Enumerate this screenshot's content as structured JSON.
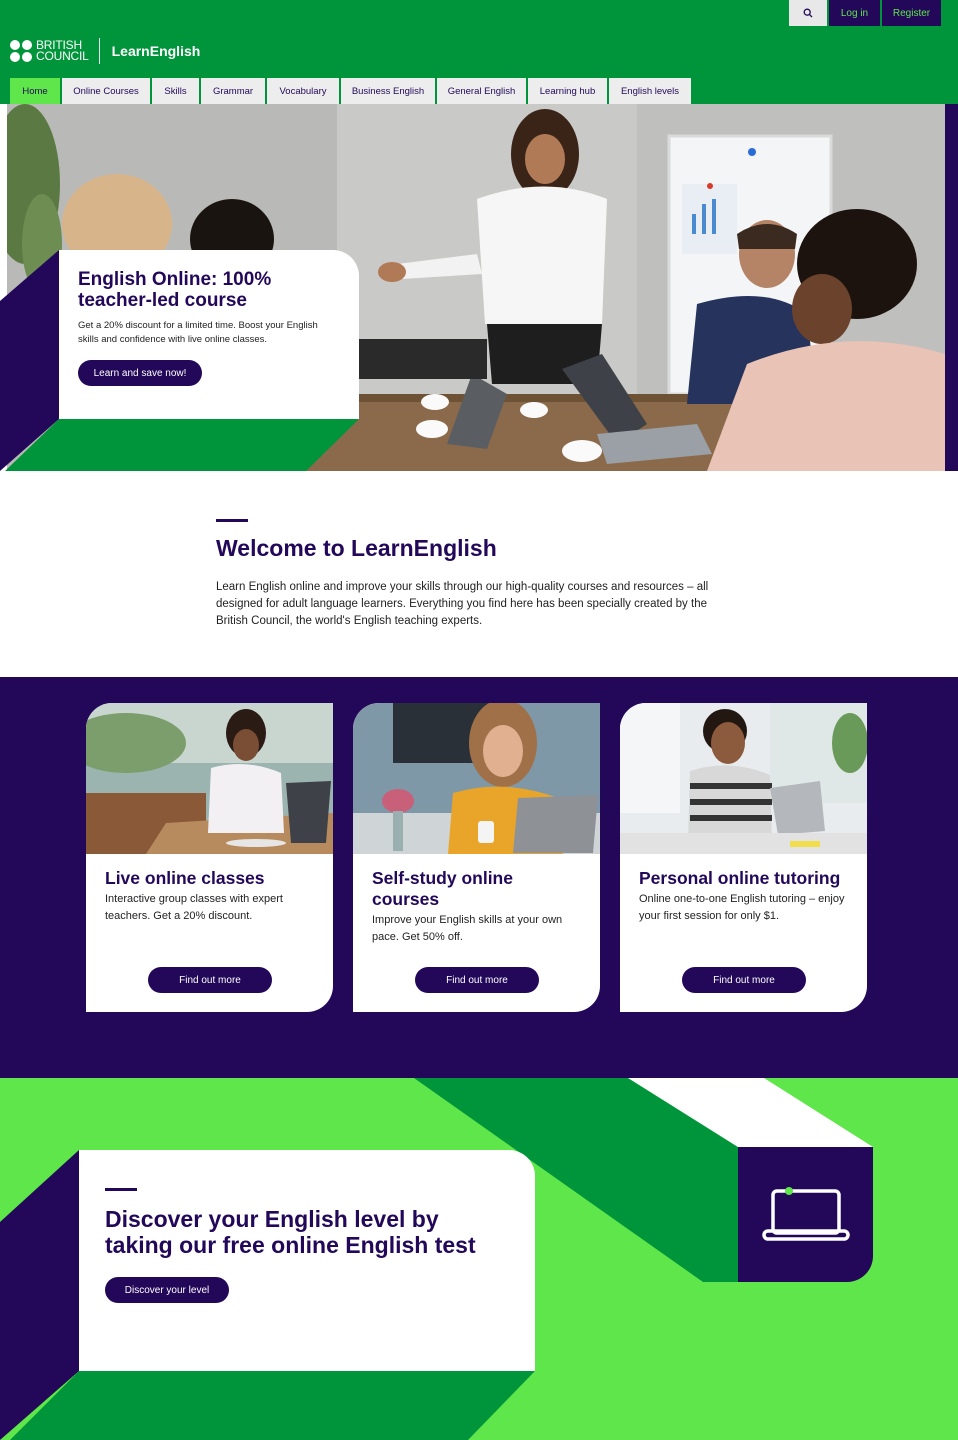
{
  "header": {
    "site_name": "LearnEnglish",
    "logo_line1": "BRITISH",
    "logo_line2": "COUNCIL",
    "search_icon": "search-icon",
    "login_label": "Log in",
    "register_label": "Register",
    "nav": [
      {
        "label": "Home",
        "active": true
      },
      {
        "label": "Online Courses"
      },
      {
        "label": "Skills"
      },
      {
        "label": "Grammar"
      },
      {
        "label": "Vocabulary"
      },
      {
        "label": "Business English"
      },
      {
        "label": "General English"
      },
      {
        "label": "Learning hub"
      },
      {
        "label": "English levels"
      }
    ]
  },
  "hero": {
    "title": "English Online: 100% teacher-led course",
    "text": "Get a 20% discount for a limited time. Boost your English skills and confidence with live online classes.",
    "button": "Learn and save now!"
  },
  "welcome": {
    "title": "Welcome to LearnEnglish",
    "text": "Learn English online and improve your skills through our high-quality courses and resources – all designed for adult language learners. Everything you find here has been specially created by the British Council, the world's English teaching experts."
  },
  "cards": [
    {
      "title": "Live online classes",
      "text": "Interactive group classes with expert teachers. Get a 20% discount.",
      "button": "Find out more"
    },
    {
      "title": "Self-study online courses",
      "text": "Improve your English skills at your own pace. Get 50% off.",
      "button": "Find out more"
    },
    {
      "title": "Personal online tutoring",
      "text": "Online one-to-one English tutoring – enjoy your first session for only $1.",
      "button": "Find out more"
    }
  ],
  "level_test": {
    "title": "Discover your English level by taking our free online English test",
    "button": "Discover your level",
    "icon": "laptop-icon"
  },
  "colors": {
    "brand_green": "#00953a",
    "light_green": "#5fe64a",
    "purple": "#23085a"
  }
}
